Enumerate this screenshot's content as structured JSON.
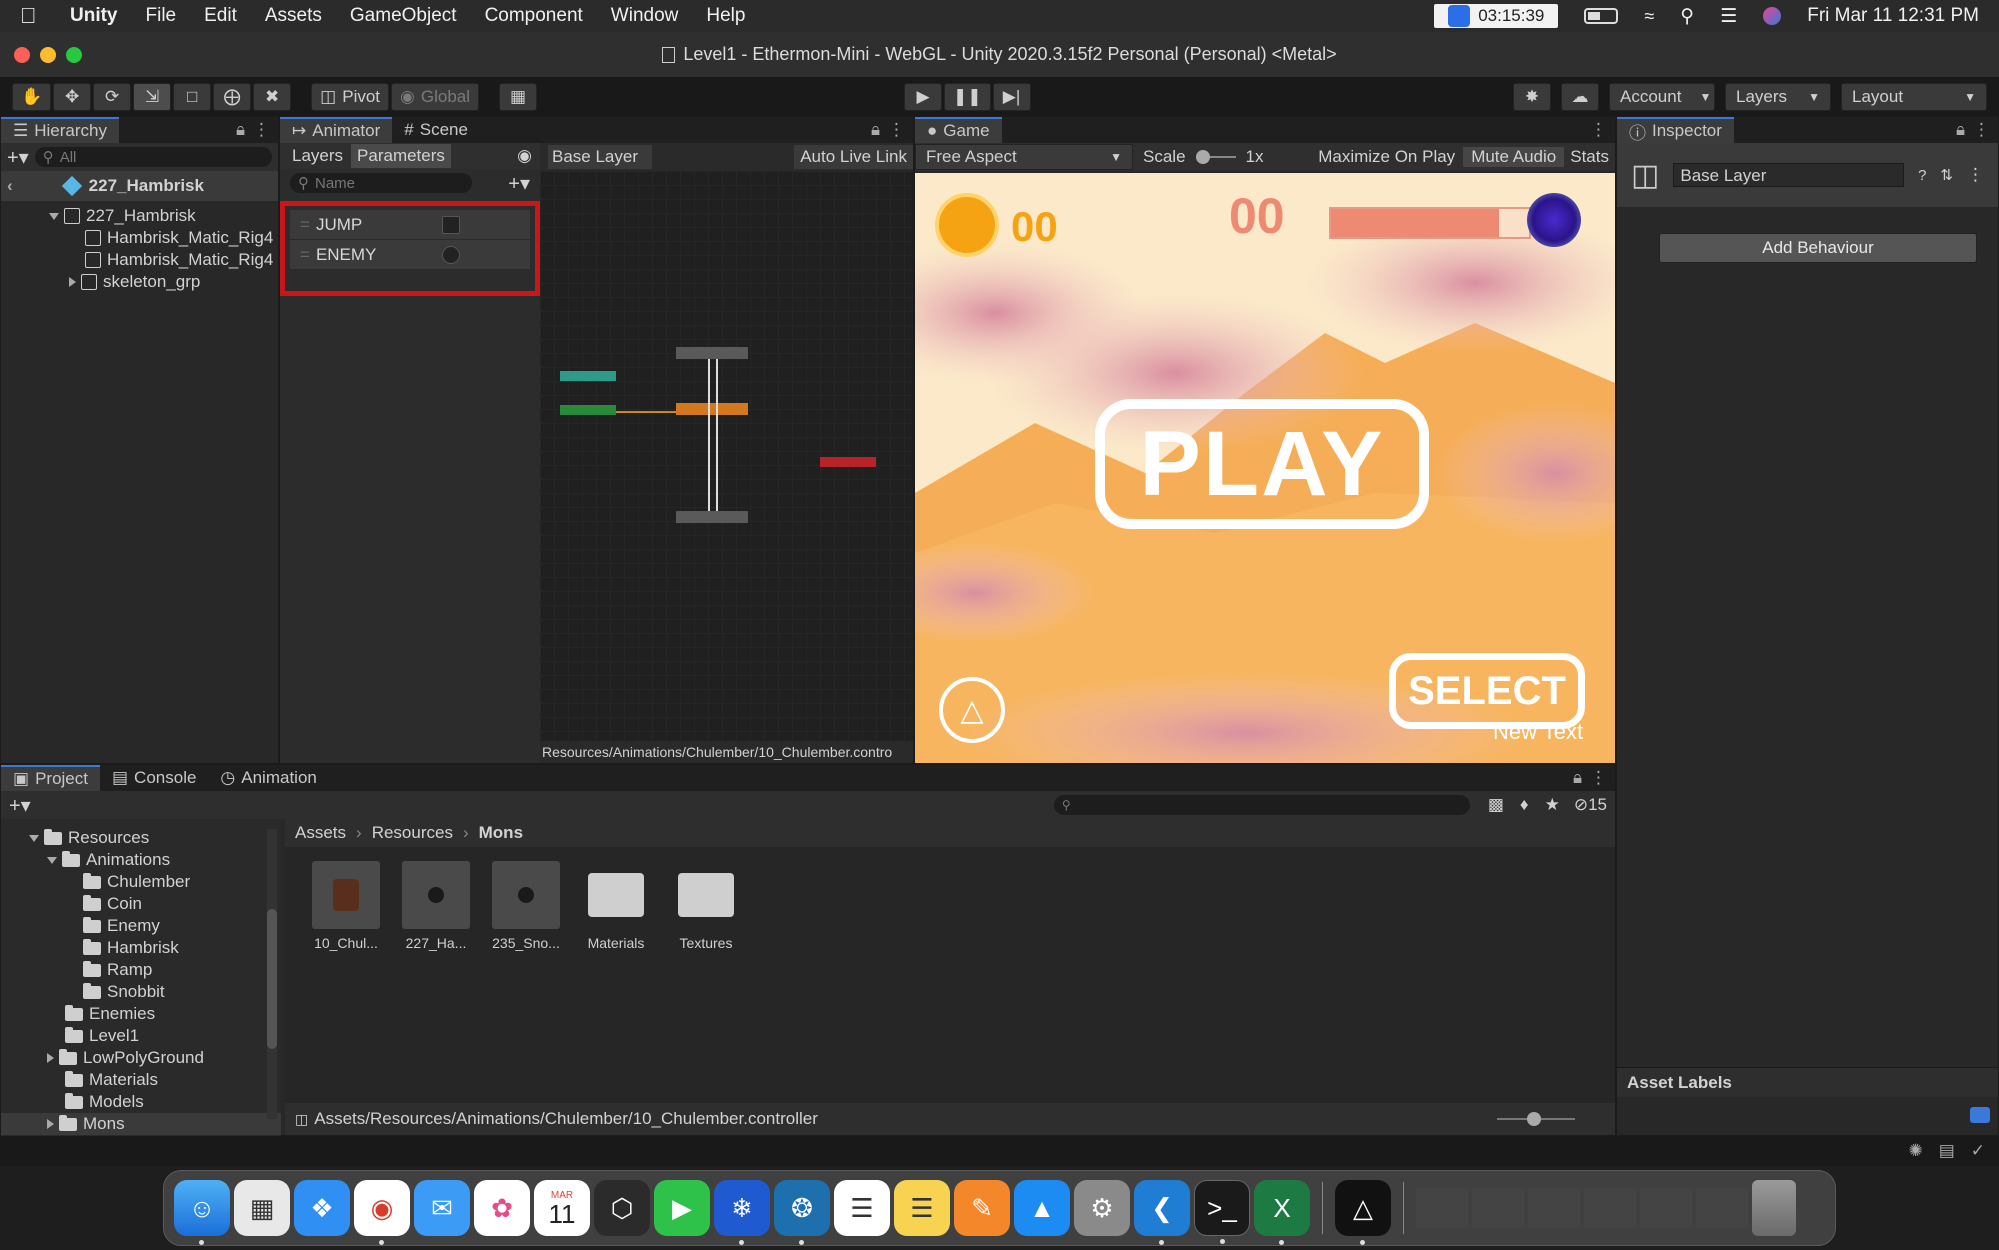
{
  "menubar": {
    "app_name": "Unity",
    "menus": [
      "File",
      "Edit",
      "Assets",
      "GameObject",
      "Component",
      "Window",
      "Help"
    ],
    "clock": "03:15:39",
    "datetime": "Fri Mar 11  12:31 PM"
  },
  "window": {
    "title": "Level1 - Ethermon-Mini - WebGL - Unity 2020.3.15f2 Personal (Personal) <Metal>"
  },
  "toolbar": {
    "pivot_label": "Pivot",
    "global_label": "Global",
    "account_label": "Account",
    "layers_label": "Layers",
    "layout_label": "Layout"
  },
  "hierarchy": {
    "tab_label": "Hierarchy",
    "search_placeholder": "All",
    "scene_root": "227_Hambrisk",
    "items": [
      {
        "label": "227_Hambrisk",
        "depth": 1,
        "expanded": true
      },
      {
        "label": "Hambrisk_Matic_Rig4",
        "depth": 2
      },
      {
        "label": "Hambrisk_Matic_Rig4",
        "depth": 2
      },
      {
        "label": "skeleton_grp",
        "depth": 2,
        "collapsed": true
      }
    ]
  },
  "animator": {
    "tab_label": "Animator",
    "scene_tab_label": "Scene",
    "layers_tab": "Layers",
    "parameters_tab": "Parameters",
    "name_placeholder": "Name",
    "breadcrumb": "Base Layer",
    "auto_live_link": "Auto Live Link",
    "parameters": [
      {
        "name": "JUMP",
        "type": "bool"
      },
      {
        "name": "ENEMY",
        "type": "trigger"
      }
    ],
    "footer_path": "Resources/Animations/Chulember/10_Chulember.contro"
  },
  "game": {
    "tab_label": "Game",
    "aspect": "Free Aspect",
    "scale_label": "Scale",
    "scale_value": "1x",
    "maximize_label": "Maximize On Play",
    "mute_label": "Mute Audio",
    "stats_label": "Stats",
    "coins": "00",
    "score": "00",
    "play_label": "PLAY",
    "select_label": "SELECT",
    "new_text": "New Text",
    "health_fill": 0.85
  },
  "inspector": {
    "tab_label": "Inspector",
    "layer_name": "Base Layer",
    "add_behaviour": "Add Behaviour",
    "asset_labels": "Asset Labels"
  },
  "project": {
    "tabs": [
      "Project",
      "Console",
      "Animation"
    ],
    "hidden_count": "15",
    "breadcrumb": [
      "Assets",
      "Resources",
      "Mons"
    ],
    "tree": [
      {
        "label": "Resources",
        "depth": 0,
        "expanded": true
      },
      {
        "label": "Animations",
        "depth": 1,
        "expanded": true
      },
      {
        "label": "Chulember",
        "depth": 2
      },
      {
        "label": "Coin",
        "depth": 2
      },
      {
        "label": "Enemy",
        "depth": 2
      },
      {
        "label": "Hambrisk",
        "depth": 2
      },
      {
        "label": "Ramp",
        "depth": 2
      },
      {
        "label": "Snobbit",
        "depth": 2
      },
      {
        "label": "Enemies",
        "depth": 1
      },
      {
        "label": "Level1",
        "depth": 1
      },
      {
        "label": "LowPolyGround",
        "depth": 1,
        "collapsed": true
      },
      {
        "label": "Materials",
        "depth": 1
      },
      {
        "label": "Models",
        "depth": 1
      },
      {
        "label": "Mons",
        "depth": 1,
        "collapsed": true,
        "selected": true
      }
    ],
    "assets": [
      {
        "label": "10_Chul...",
        "kind": "model"
      },
      {
        "label": "227_Ha...",
        "kind": "model"
      },
      {
        "label": "235_Sno...",
        "kind": "model"
      },
      {
        "label": "Materials",
        "kind": "folder"
      },
      {
        "label": "Textures",
        "kind": "folder"
      }
    ],
    "footer_path": "Assets/Resources/Animations/Chulember/10_Chulember.controller"
  },
  "dock": {
    "icons": [
      "finder-icon",
      "launchpad-icon",
      "safari-icon",
      "chrome-icon",
      "mail-icon",
      "photos-icon",
      "calendar-icon",
      "unity-hub-icon",
      "facetime-icon",
      "sourcetree-icon",
      "mysql-workbench-icon",
      "reminders-icon",
      "notes-icon",
      "pages-icon",
      "app-store-icon",
      "system-preferences-icon",
      "vscode-icon",
      "terminal-icon",
      "excel-icon",
      "unity-icon"
    ],
    "calendar_month": "MAR",
    "calendar_day": "11"
  }
}
